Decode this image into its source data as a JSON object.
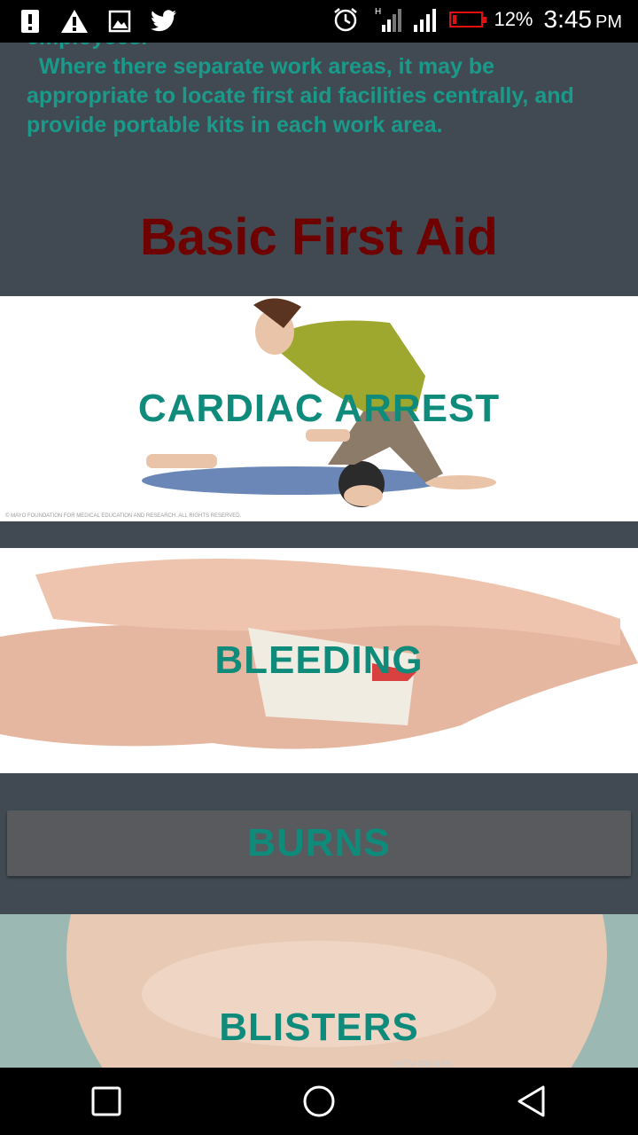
{
  "status_bar": {
    "battery_percent": "12%",
    "time": "3:45",
    "ampm": "PM",
    "icons": [
      "alert-icon",
      "warning-icon",
      "image-icon",
      "twitter-icon",
      "alarm-icon",
      "signal-h-icon",
      "signal-icon",
      "battery-icon"
    ]
  },
  "intro": {
    "text": "employees.\n  Where there separate work areas, it may be appropriate to locate first aid facilities centrally, and provide portable kits in each work area."
  },
  "section": {
    "title": "Basic First Aid"
  },
  "topics": {
    "cardiac_arrest": "CARDIAC ARREST",
    "bleeding": "BLEEDING",
    "burns": "BURNS",
    "blisters": "BLISTERS"
  },
  "image_credits": {
    "cardiac": "© MAYO FOUNDATION FOR MEDICAL EDUCATION AND RESEARCH. ALL RIGHTS RESERVED.",
    "blisters": "gettyimages"
  },
  "colors": {
    "background": "#414a52",
    "accent_teal": "#0e8b7a",
    "title_red": "#6e0000"
  },
  "nav_bar": {
    "icons": [
      "recents-square-icon",
      "home-circle-icon",
      "back-triangle-icon"
    ]
  }
}
